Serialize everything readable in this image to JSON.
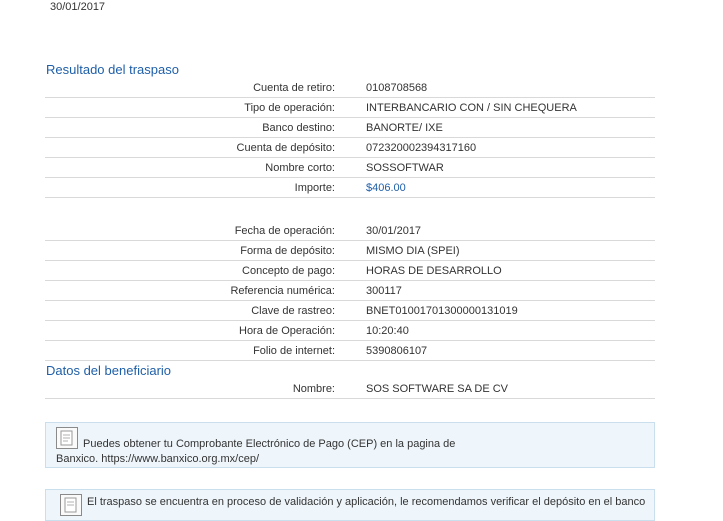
{
  "header": {
    "date": "30/01/2017"
  },
  "result": {
    "title": "Resultado del traspaso",
    "rows_a": [
      {
        "label": "Cuenta de retiro:",
        "value": "0108708568"
      },
      {
        "label": "Tipo de operación:",
        "value": "INTERBANCARIO CON / SIN CHEQUERA"
      },
      {
        "label": "Banco destino:",
        "value": "BANORTE/ IXE"
      },
      {
        "label": "Cuenta de depósito:",
        "value": "072320002394317160"
      },
      {
        "label": "Nombre corto:",
        "value": "SOSSOFTWAR"
      },
      {
        "label": "Importe:",
        "value": "$406.00"
      }
    ],
    "rows_b": [
      {
        "label": "Fecha de operación:",
        "value": "30/01/2017"
      },
      {
        "label": "Forma de depósito:",
        "value": "MISMO DIA (SPEI)"
      },
      {
        "label": "Concepto de pago:",
        "value": "HORAS DE DESARROLLO"
      },
      {
        "label": "Referencia numérica:",
        "value": "300117"
      },
      {
        "label": "Clave de rastreo:",
        "value": "BNET01001701300000131019"
      },
      {
        "label": "Hora de Operación:",
        "value": "10:20:40"
      },
      {
        "label": "Folio de internet:",
        "value": "5390806107"
      }
    ]
  },
  "beneficiary": {
    "title": "Datos del beneficiario",
    "name_label": "Nombre:",
    "name_value": "SOS SOFTWARE SA DE CV"
  },
  "cep_notice": {
    "text_line1": "Puedes obtener tu Comprobante Electrónico de Pago (CEP) en la pagina de",
    "text_line2_prefix": "Banxico.",
    "link": "https://www.banxico.org.mx/cep/"
  },
  "validation_notice": {
    "text": "El traspaso se encuentra en proceso de validación y aplicación, le recomendamos verificar el depósito en el banco"
  },
  "colors": {
    "accent": "#1f5fa8",
    "box_bg": "#eef6fb",
    "box_border": "#c9dfee",
    "divider": "#d9d9d9"
  },
  "icons": {
    "document": "document-icon"
  }
}
